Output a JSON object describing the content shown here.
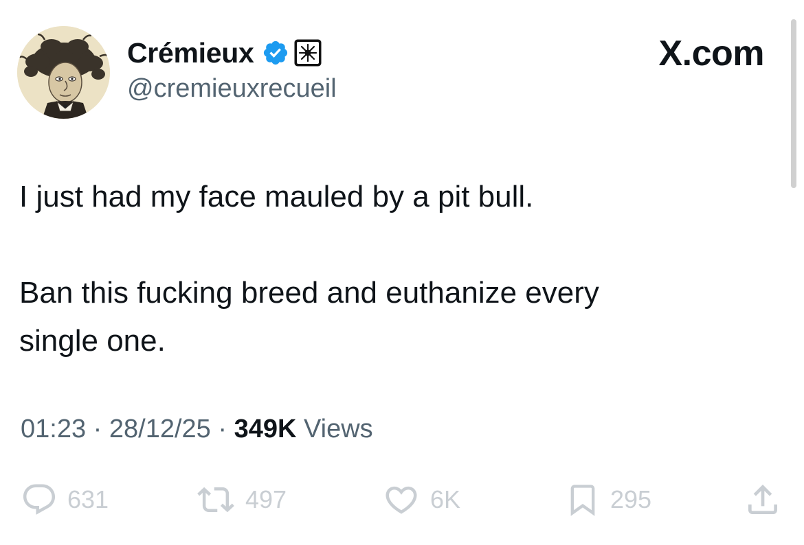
{
  "tweet": {
    "author": {
      "display_name": "Crémieux",
      "handle": "@cremieuxrecueil"
    },
    "site_label": "X.com",
    "text": {
      "line1": "I just had my face mauled by a pit bull.",
      "line2": "Ban this fucking breed and euthanize every",
      "line3": "single one."
    },
    "meta": {
      "time": "01:23",
      "separator": "·",
      "date": "28/12/25",
      "views_count": "349K",
      "views_label": "Views"
    },
    "actions": {
      "replies": "631",
      "reposts": "497",
      "likes": "6K",
      "bookmarks": "295"
    }
  },
  "icons": {
    "verified": "verified-badge-icon",
    "affiliate": "affiliate-badge-icon",
    "reply": "reply-icon",
    "repost": "repost-icon",
    "like": "heart-icon",
    "bookmark": "bookmark-icon",
    "share": "share-icon"
  },
  "colors": {
    "verified_blue": "#1d9bf0",
    "text_primary": "#0f1419",
    "text_secondary": "#536471",
    "action_icons": "#c9ced3"
  }
}
